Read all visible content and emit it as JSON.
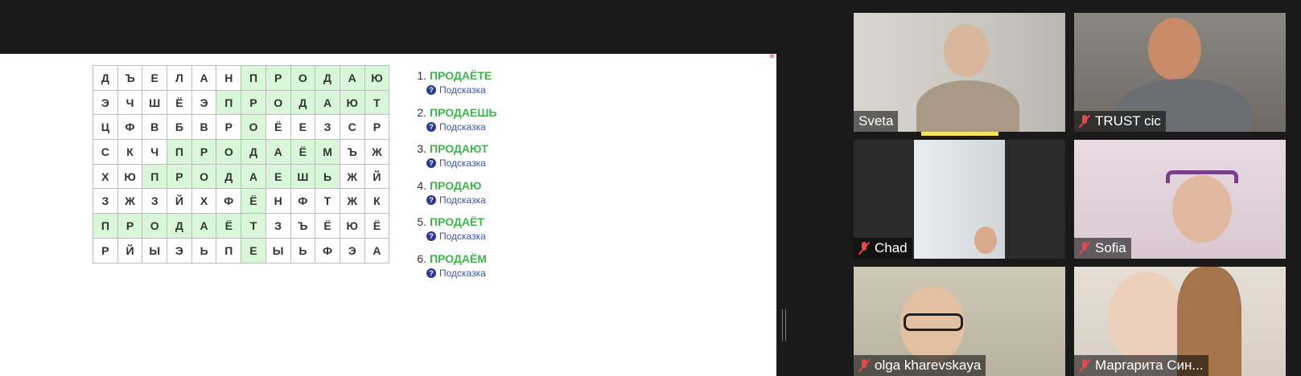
{
  "puzzle": {
    "grid": [
      [
        "Д",
        "Ъ",
        "Е",
        "Л",
        "А",
        "Н",
        "П",
        "Р",
        "О",
        "Д",
        "А",
        "Ю"
      ],
      [
        "Э",
        "Ч",
        "Ш",
        "Ё",
        "Э",
        "П",
        "П",
        "Р",
        "О",
        "Д",
        "А",
        "Ю",
        "Т"
      ],
      [
        "Ц",
        "Ф",
        "В",
        "Б",
        "В",
        "Р",
        "О",
        "Ё",
        "Е",
        "З",
        "С",
        "Р"
      ],
      [
        "С",
        "К",
        "Ч",
        "П",
        "Р",
        "О",
        "Д",
        "А",
        "Ё",
        "М",
        "Ъ",
        "Ж"
      ],
      [
        "Х",
        "Ю",
        "П",
        "Р",
        "О",
        "Д",
        "А",
        "Е",
        "Ш",
        "Ь",
        "Ж",
        "Й"
      ],
      [
        "З",
        "Ж",
        "З",
        "Й",
        "Х",
        "Ф",
        "Ё",
        "Н",
        "Ф",
        "Т",
        "Ж",
        "К"
      ],
      [
        "П",
        "Р",
        "О",
        "Д",
        "А",
        "Ё",
        "Т",
        "З",
        "Ъ",
        "Ё",
        "Ю",
        "Ё"
      ],
      [
        "Р",
        "Й",
        "Ы",
        "Э",
        "Ь",
        "П",
        "Е",
        "Ы",
        "Ь",
        "Ф",
        "Э",
        "А"
      ]
    ],
    "words": [
      {
        "num": "1.",
        "text": "ПРОДАЁТЕ",
        "hint": "Подсказка"
      },
      {
        "num": "2.",
        "text": "ПРОДАЕШЬ",
        "hint": "Подсказка"
      },
      {
        "num": "3.",
        "text": "ПРОДАЮТ",
        "hint": "Подсказка"
      },
      {
        "num": "4.",
        "text": "ПРОДАЮ",
        "hint": "Подсказка"
      },
      {
        "num": "5.",
        "text": "ПРОДАЁТ",
        "hint": "Подсказка"
      },
      {
        "num": "6.",
        "text": "ПРОДАЁМ",
        "hint": "Подсказка"
      }
    ]
  },
  "participants": [
    {
      "name": "Sveta",
      "muted": false,
      "speaking": true
    },
    {
      "name": "TRUST cic",
      "muted": true,
      "speaking": false
    },
    {
      "name": "Chad",
      "muted": true,
      "speaking": false
    },
    {
      "name": "Sofia",
      "muted": true,
      "speaking": false
    },
    {
      "name": "olga kharevskaya",
      "muted": true,
      "speaking": false
    },
    {
      "name": "Маргарита Син...",
      "muted": true,
      "speaking": false
    }
  ],
  "colors": {
    "highlight": "#d7f7d8",
    "word": "#3cb54a",
    "hint": "#3a53a4",
    "muted": "#e5484d",
    "speaking": "#f6e45c"
  }
}
